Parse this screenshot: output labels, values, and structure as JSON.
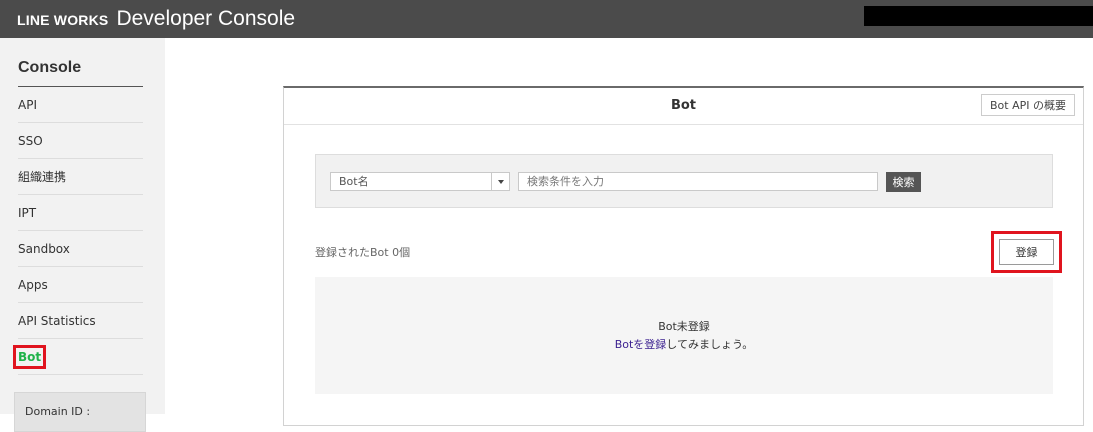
{
  "header": {
    "logo": "LINE WORKS",
    "title": "Developer Console"
  },
  "sidebar": {
    "heading": "Console",
    "items": [
      {
        "label": "API"
      },
      {
        "label": "SSO"
      },
      {
        "label": "組織連携"
      },
      {
        "label": "IPT"
      },
      {
        "label": "Sandbox"
      },
      {
        "label": "Apps"
      },
      {
        "label": "API Statistics"
      },
      {
        "label": "Bot",
        "active": true
      }
    ],
    "domain_label": "Domain ID :"
  },
  "main": {
    "title": "Bot",
    "overview_button": "Bot API の概要",
    "search": {
      "select_value": "Bot名",
      "input_placeholder": "検索条件を入力",
      "button": "検索"
    },
    "count_text": "登録されたBot 0個",
    "register_button": "登録",
    "empty": {
      "title": "Bot未登録",
      "link": "Botを登録",
      "suffix": "してみましょう。"
    }
  },
  "colors": {
    "header_bg": "#4b4b4b",
    "active_nav": "#1fb34a",
    "highlight": "#e0141e",
    "link": "#3a1f8f"
  }
}
